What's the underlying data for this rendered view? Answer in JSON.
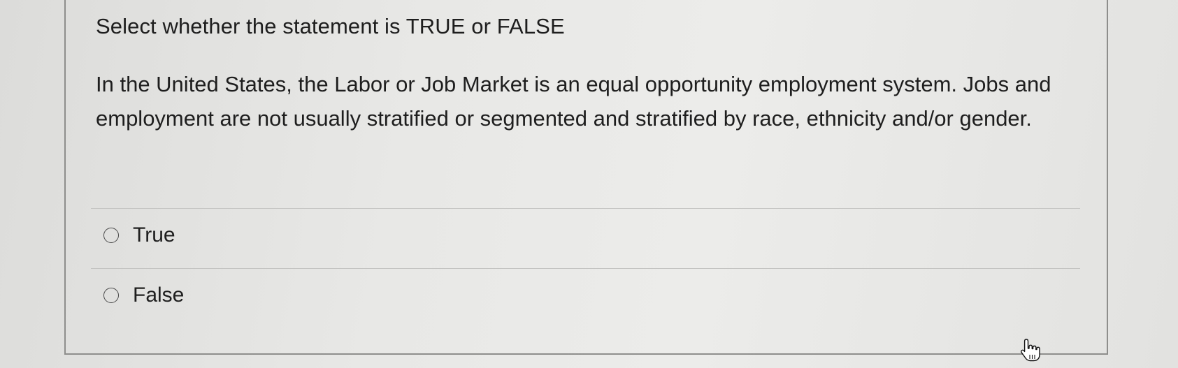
{
  "question": {
    "prompt": "Select whether the statement is TRUE or FALSE",
    "statement": "In the United States, the Labor or Job Market is an equal opportunity employment system. Jobs and employment are not usually stratified or segmented and stratified by race, ethnicity and/or gender."
  },
  "options": [
    {
      "label": "True",
      "selected": false
    },
    {
      "label": "False",
      "selected": false
    }
  ],
  "cursor": {
    "icon": "hand-pointer-icon"
  }
}
